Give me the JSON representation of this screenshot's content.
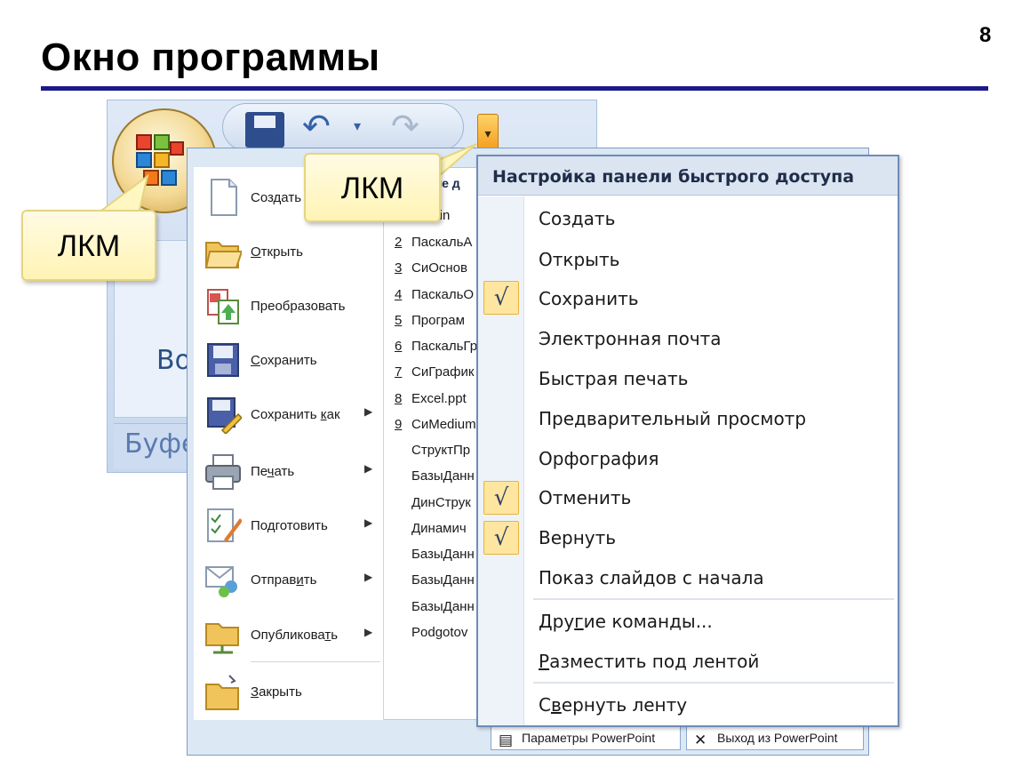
{
  "slide": {
    "title": "Окно программы",
    "page_number": "8"
  },
  "ribbon": {
    "group_label": "Буфе",
    "big_text": "Во"
  },
  "callouts": {
    "left": "ЛКМ",
    "top": "ЛКМ"
  },
  "office_menu": {
    "items": [
      {
        "label": "Создать",
        "icon": "new-document-icon",
        "has_submenu": false
      },
      {
        "label": "Открыть",
        "icon": "open-folder-icon",
        "has_submenu": false
      },
      {
        "label": "Преобразовать",
        "icon": "convert-icon",
        "has_submenu": false
      },
      {
        "label": "Сохранить",
        "icon": "save-icon",
        "has_submenu": false
      },
      {
        "label": "Сохранить как",
        "icon": "save-as-icon",
        "has_submenu": true
      },
      {
        "label": "Печать",
        "icon": "printer-icon",
        "has_submenu": true
      },
      {
        "label": "Подготовить",
        "icon": "prepare-icon",
        "has_submenu": true
      },
      {
        "label": "Отправить",
        "icon": "send-icon",
        "has_submenu": true
      },
      {
        "label": "Опубликовать",
        "icon": "publish-icon",
        "has_submenu": true
      },
      {
        "label": "Закрыть",
        "icon": "close-folder-icon",
        "has_submenu": false
      }
    ],
    "recent_header": "ние д",
    "recent_items": [
      {
        "num": "",
        "name": "erPoin"
      },
      {
        "num": "2",
        "name": "ПаскальА"
      },
      {
        "num": "3",
        "name": "СиОснов"
      },
      {
        "num": "4",
        "name": "ПаскальО"
      },
      {
        "num": "5",
        "name": "Програм"
      },
      {
        "num": "6",
        "name": "ПаскальГр"
      },
      {
        "num": "7",
        "name": "СиГрафик"
      },
      {
        "num": "8",
        "name": "Excel.ppt"
      },
      {
        "num": "9",
        "name": "СиMedium"
      },
      {
        "num": "",
        "name": "СтруктПр"
      },
      {
        "num": "",
        "name": "БазыДанн"
      },
      {
        "num": "",
        "name": "ДинСтрук"
      },
      {
        "num": "",
        "name": "Динамич"
      },
      {
        "num": "",
        "name": "БазыДанн"
      },
      {
        "num": "",
        "name": "БазыДанн"
      },
      {
        "num": "",
        "name": "БазыДанн"
      },
      {
        "num": "",
        "name": "Podgotov"
      }
    ],
    "options_button": "Параметры PowerPoint",
    "exit_button": "Выход из PowerPoint"
  },
  "qat_menu": {
    "title": "Настройка панели быстрого доступа",
    "check_mark": "√",
    "items": [
      {
        "label": "Создать",
        "checked": false
      },
      {
        "label": "Открыть",
        "checked": false
      },
      {
        "label": "Сохранить",
        "checked": true
      },
      {
        "label": "Электронная почта",
        "checked": false
      },
      {
        "label": "Быстрая печать",
        "checked": false
      },
      {
        "label": "Предварительный просмотр",
        "checked": false
      },
      {
        "label": "Орфография",
        "checked": false
      },
      {
        "label": "Отменить",
        "checked": true
      },
      {
        "label": "Вернуть",
        "checked": true
      },
      {
        "label": "Показ слайдов с начала",
        "checked": false
      }
    ],
    "more_commands": "Другие команды...",
    "place_below": "Разместить под лентой",
    "minimize_ribbon": "Свернуть ленту"
  },
  "colors": {
    "title_rule": "#1a1a8a",
    "callout_fill": "#fff4b5",
    "check_fill": "#ffe6a0",
    "menu_header": "#dbe5f1"
  }
}
